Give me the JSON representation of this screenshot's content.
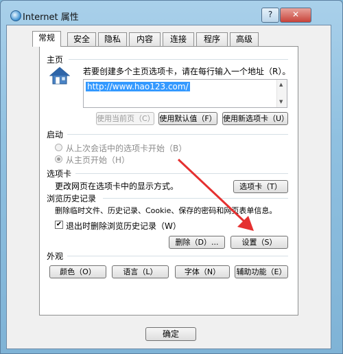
{
  "window": {
    "title": "Internet 属性",
    "help_label": "?",
    "close_label": "✕"
  },
  "tabs": [
    {
      "label": "常规",
      "active": true
    },
    {
      "label": "安全"
    },
    {
      "label": "隐私"
    },
    {
      "label": "内容"
    },
    {
      "label": "连接"
    },
    {
      "label": "程序"
    },
    {
      "label": "高级"
    }
  ],
  "homepage": {
    "section_label": "主页",
    "instruction": "若要创建多个主页选项卡，请在每行输入一个地址（R）。",
    "url_value": "http://www.hao123.com/",
    "buttons": {
      "use_current": "使用当前页（C）",
      "use_default": "使用默认值（F）",
      "use_new_tab": "使用新选项卡（U）"
    }
  },
  "startup": {
    "section_label": "启动",
    "option_last_session": "从上次会话中的选项卡开始（B）",
    "option_homepage": "从主页开始（H）"
  },
  "tabs_section": {
    "section_label": "选项卡",
    "description": "更改网页在选项卡中的显示方式。",
    "button": "选项卡（T）"
  },
  "history": {
    "section_label": "浏览历史记录",
    "description": "删除临时文件、历史记录、Cookie、保存的密码和网页表单信息。",
    "checkbox_label": "退出时删除浏览历史记录（W）",
    "checkbox_checked": true,
    "delete_button": "删除（D）...",
    "settings_button": "设置（S）"
  },
  "appearance": {
    "section_label": "外观",
    "buttons": {
      "colors": "颜色（O）",
      "languages": "语言（L）",
      "fonts": "字体（N）",
      "accessibility": "辅助功能（E）"
    }
  },
  "footer": {
    "ok_button": "确定"
  },
  "colors": {
    "title_bar": "#8fc0e0",
    "close_button": "#c8433a",
    "selection": "#3399ff",
    "annotation_arrow": "#e53030"
  },
  "icons": {
    "app": "ie-globe-icon",
    "home": "house-icon"
  }
}
